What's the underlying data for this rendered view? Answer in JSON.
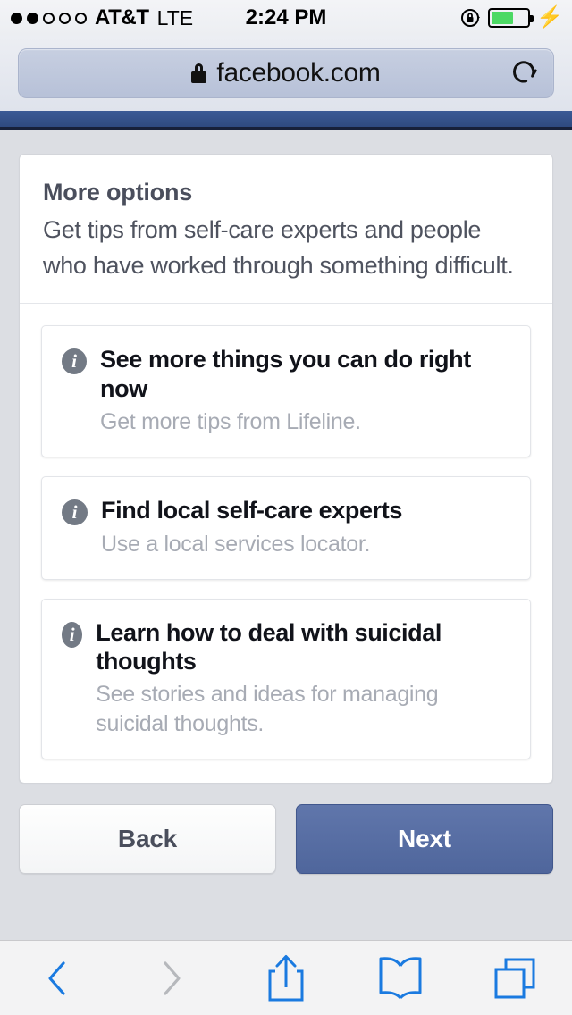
{
  "status_bar": {
    "signal_dots_total": 5,
    "signal_dots_filled": 2,
    "carrier": "AT&T",
    "network": "LTE",
    "time": "2:24 PM",
    "orientation_lock_icon": "rotation-lock-icon",
    "battery_percent": 62,
    "battery_color": "#4cd964",
    "charging_icon": "⚡"
  },
  "browser": {
    "url": "facebook.com",
    "lock_icon": "lock-icon",
    "reload_icon": "reload-icon",
    "toolbar": {
      "back_icon": "chevron-left-icon",
      "forward_icon": "chevron-right-icon",
      "share_icon": "share-icon",
      "bookmarks_icon": "book-icon",
      "tabs_icon": "tabs-icon",
      "active_color": "#1a7ae0",
      "disabled_color": "#b6b8bc"
    }
  },
  "brand": {
    "navbar_color": "#3b5a96"
  },
  "card": {
    "title": "More options",
    "subtitle": "Get tips from self-care experts and people who have worked through something difficult.",
    "options": [
      {
        "icon": "info-icon",
        "title": "See more things you can do right now",
        "description": "Get more tips from Lifeline."
      },
      {
        "icon": "info-icon",
        "title": "Find local self-care experts",
        "description": "Use a local services locator."
      },
      {
        "icon": "info-icon",
        "title": "Learn how to deal with suicidal thoughts",
        "description": "See stories and ideas for managing suicidal thoughts."
      }
    ]
  },
  "footer": {
    "back_label": "Back",
    "next_label": "Next",
    "next_color": "#546b9f"
  },
  "icon_glyphs": {
    "info": "i"
  }
}
